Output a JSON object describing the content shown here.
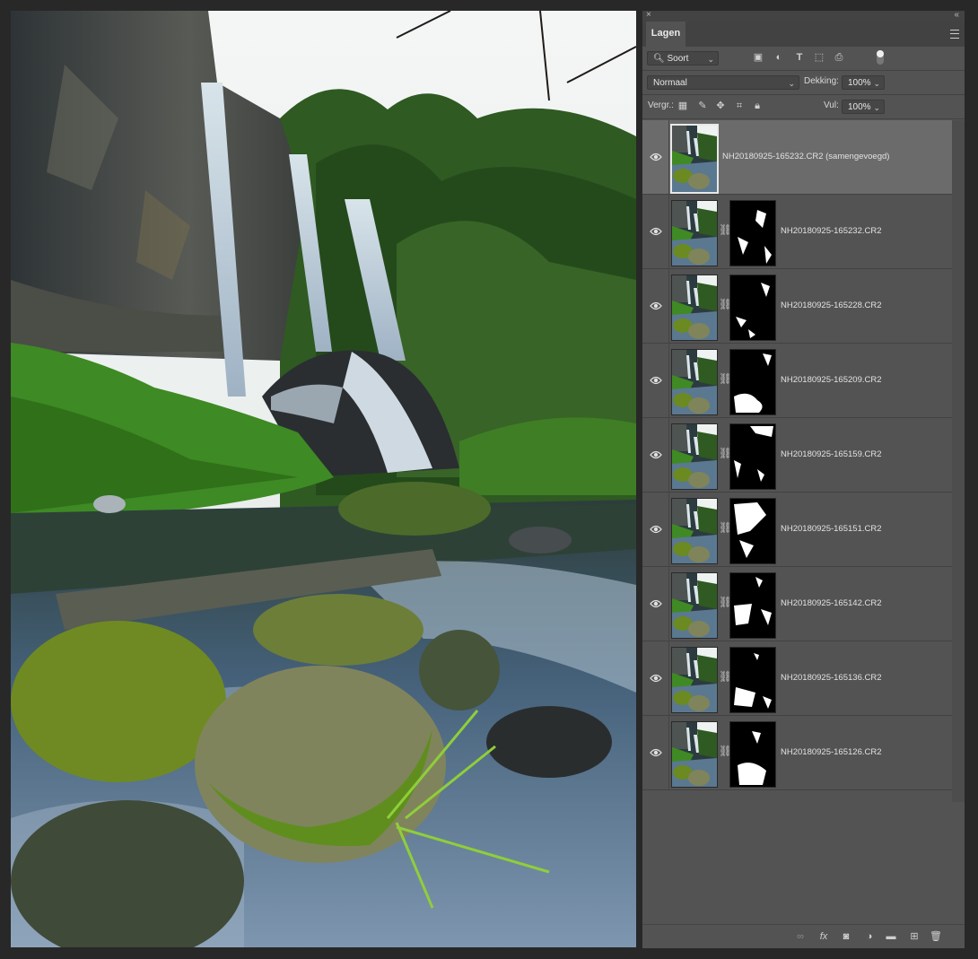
{
  "panel": {
    "tab_label": "Lagen",
    "filter": {
      "label": "Soort"
    },
    "blend_mode": "Normaal",
    "opacity": {
      "label": "Dekking:",
      "value": "100%"
    },
    "lock": {
      "label": "Vergr.:"
    },
    "fill": {
      "label": "Vul:",
      "value": "100%"
    },
    "filter_icons": [
      "image-filter-icon",
      "adjustment-filter-icon",
      "type-filter-icon",
      "shape-filter-icon",
      "smart-object-filter-icon"
    ],
    "lock_icons": [
      "lock-transparent-icon",
      "lock-image-icon",
      "lock-position-icon",
      "lock-artboard-icon",
      "lock-all-icon"
    ],
    "footer_icons": [
      "link-layers-icon",
      "fx-icon",
      "add-mask-icon",
      "adjustment-layer-icon",
      "group-folder-icon",
      "new-layer-icon",
      "trash-icon"
    ]
  },
  "layers": [
    {
      "name": "NH20180925-165232.CR2 (samengevoegd)",
      "selected": true,
      "has_mask": false
    },
    {
      "name": "NH20180925-165232.CR2",
      "selected": false,
      "has_mask": true
    },
    {
      "name": "NH20180925-165228.CR2",
      "selected": false,
      "has_mask": true
    },
    {
      "name": "NH20180925-165209.CR2",
      "selected": false,
      "has_mask": true
    },
    {
      "name": "NH20180925-165159.CR2",
      "selected": false,
      "has_mask": true
    },
    {
      "name": "NH20180925-165151.CR2",
      "selected": false,
      "has_mask": true
    },
    {
      "name": "NH20180925-165142.CR2",
      "selected": false,
      "has_mask": true
    },
    {
      "name": "NH20180925-165136.CR2",
      "selected": false,
      "has_mask": true
    },
    {
      "name": "NH20180925-165126.CR2",
      "selected": false,
      "has_mask": true
    }
  ],
  "colors": {
    "panel_bg": "#535353",
    "selected_row": "#6b6b6b",
    "app_bg": "#282828"
  }
}
